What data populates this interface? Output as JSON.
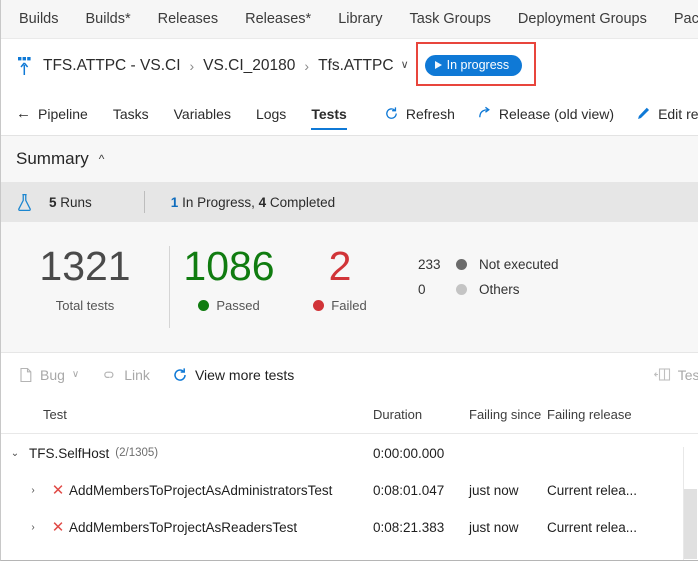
{
  "topnav": {
    "items": [
      {
        "label": "Builds"
      },
      {
        "label": "Builds*"
      },
      {
        "label": "Releases"
      },
      {
        "label": "Releases*"
      },
      {
        "label": "Library"
      },
      {
        "label": "Task Groups"
      },
      {
        "label": "Deployment Groups"
      },
      {
        "label": "Packages"
      }
    ]
  },
  "breadcrumb": {
    "icon": "release-rocket-icon",
    "items": [
      {
        "label": "TFS.ATTPC - VS.CI"
      },
      {
        "label": "VS.CI_20180"
      },
      {
        "label": "Tfs.ATTPC"
      }
    ],
    "separator": "›",
    "caret": "∨",
    "status_badge": {
      "label": "In progress",
      "icon": "play-icon",
      "color": "#0f79d6",
      "highlight_color": "#e8453c"
    }
  },
  "tabs": {
    "back_label": "Pipeline",
    "back_icon": "arrow-left-icon",
    "items": [
      {
        "label": "Tasks",
        "active": false
      },
      {
        "label": "Variables",
        "active": false
      },
      {
        "label": "Logs",
        "active": false
      },
      {
        "label": "Tests",
        "active": true
      }
    ],
    "actions": [
      {
        "label": "Refresh",
        "icon": "refresh-icon"
      },
      {
        "label": "Release (old view)",
        "icon": "external-arrow-icon"
      },
      {
        "label": "Edit re",
        "icon": "pencil-icon"
      }
    ]
  },
  "summary": {
    "title": "Summary",
    "collapse_icon": "chevron-up-icon",
    "runs": {
      "icon": "flask-icon",
      "count": "5",
      "label": "Runs",
      "progress_count": "1",
      "progress_label": "In Progress,",
      "completed_count": "4",
      "completed_label": "Completed"
    },
    "stats": {
      "total": {
        "value": "1321",
        "label": "Total tests"
      },
      "passed": {
        "value": "1086",
        "label": "Passed",
        "color": "#107c10"
      },
      "failed": {
        "value": "2",
        "label": "Failed",
        "color": "#d13438"
      },
      "not_executed": {
        "value": "233",
        "label": "Not executed",
        "color": "#6b6b6b"
      },
      "others": {
        "value": "0",
        "label": "Others",
        "color": "#c4c4c4"
      }
    }
  },
  "actionbar": {
    "bug": {
      "label": "Bug",
      "icon": "bug-file-icon",
      "caret": "∨"
    },
    "link": {
      "label": "Link",
      "icon": "link-icon"
    },
    "view_more": {
      "label": "View more tests",
      "icon": "refresh-icon"
    },
    "test_panel": {
      "label": "Test r",
      "icon": "panel-icon"
    }
  },
  "table": {
    "columns": [
      {
        "label": "Test"
      },
      {
        "label": "Duration"
      },
      {
        "label": "Failing since"
      },
      {
        "label": "Failing release"
      }
    ],
    "rows": [
      {
        "type": "group",
        "twisty": "⌄",
        "name": "TFS.SelfHost",
        "count": "(2/1305)",
        "duration": "0:00:00.000",
        "failing_since": "",
        "failing_release": ""
      },
      {
        "type": "test",
        "twisty": "›",
        "status_icon": "failed-x-icon",
        "name": "AddMembersToProjectAsAdministratorsTest",
        "duration": "0:08:01.047",
        "failing_since": "just now",
        "failing_release": "Current relea..."
      },
      {
        "type": "test",
        "twisty": "›",
        "status_icon": "failed-x-icon",
        "name": "AddMembersToProjectAsReadersTest",
        "duration": "0:08:21.383",
        "failing_since": "just now",
        "failing_release": "Current relea..."
      }
    ]
  }
}
